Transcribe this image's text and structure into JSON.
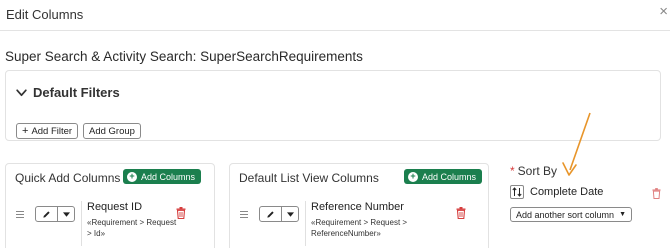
{
  "modal": {
    "title": "Edit Columns",
    "close_glyph": "×"
  },
  "page": {
    "title": "Super Search & Activity Search: SuperSearchRequirements"
  },
  "filters": {
    "toggle_label": "Default Filters",
    "add_filter_label": "Add Filter",
    "add_group_label": "Add Group"
  },
  "quick_add": {
    "title": "Quick Add Columns",
    "add_button": "Add Columns",
    "rows": [
      {
        "name": "Request ID",
        "path": "«Requirement > Request > Id»"
      }
    ]
  },
  "default_list": {
    "title": "Default List View Columns",
    "add_button": "Add Columns",
    "rows": [
      {
        "name": "Reference Number",
        "path": "«Requirement > Request > ReferenceNumber»"
      }
    ]
  },
  "sort": {
    "required_mark": "*",
    "title": "Sort By",
    "item_label": "Complete Date",
    "add_another_label": "Add another sort column"
  },
  "colors": {
    "accent_green": "#1b7f4e",
    "danger_red": "#d63c3c",
    "annotation_arrow": "#e8952a"
  },
  "icons": {
    "close": "close-icon",
    "chevron": "chevron-down-icon",
    "plus": "plus-icon",
    "pencil": "pencil-icon",
    "trash": "trash-icon",
    "drag": "drag-handle-icon",
    "sort": "sort-direction-icon"
  }
}
